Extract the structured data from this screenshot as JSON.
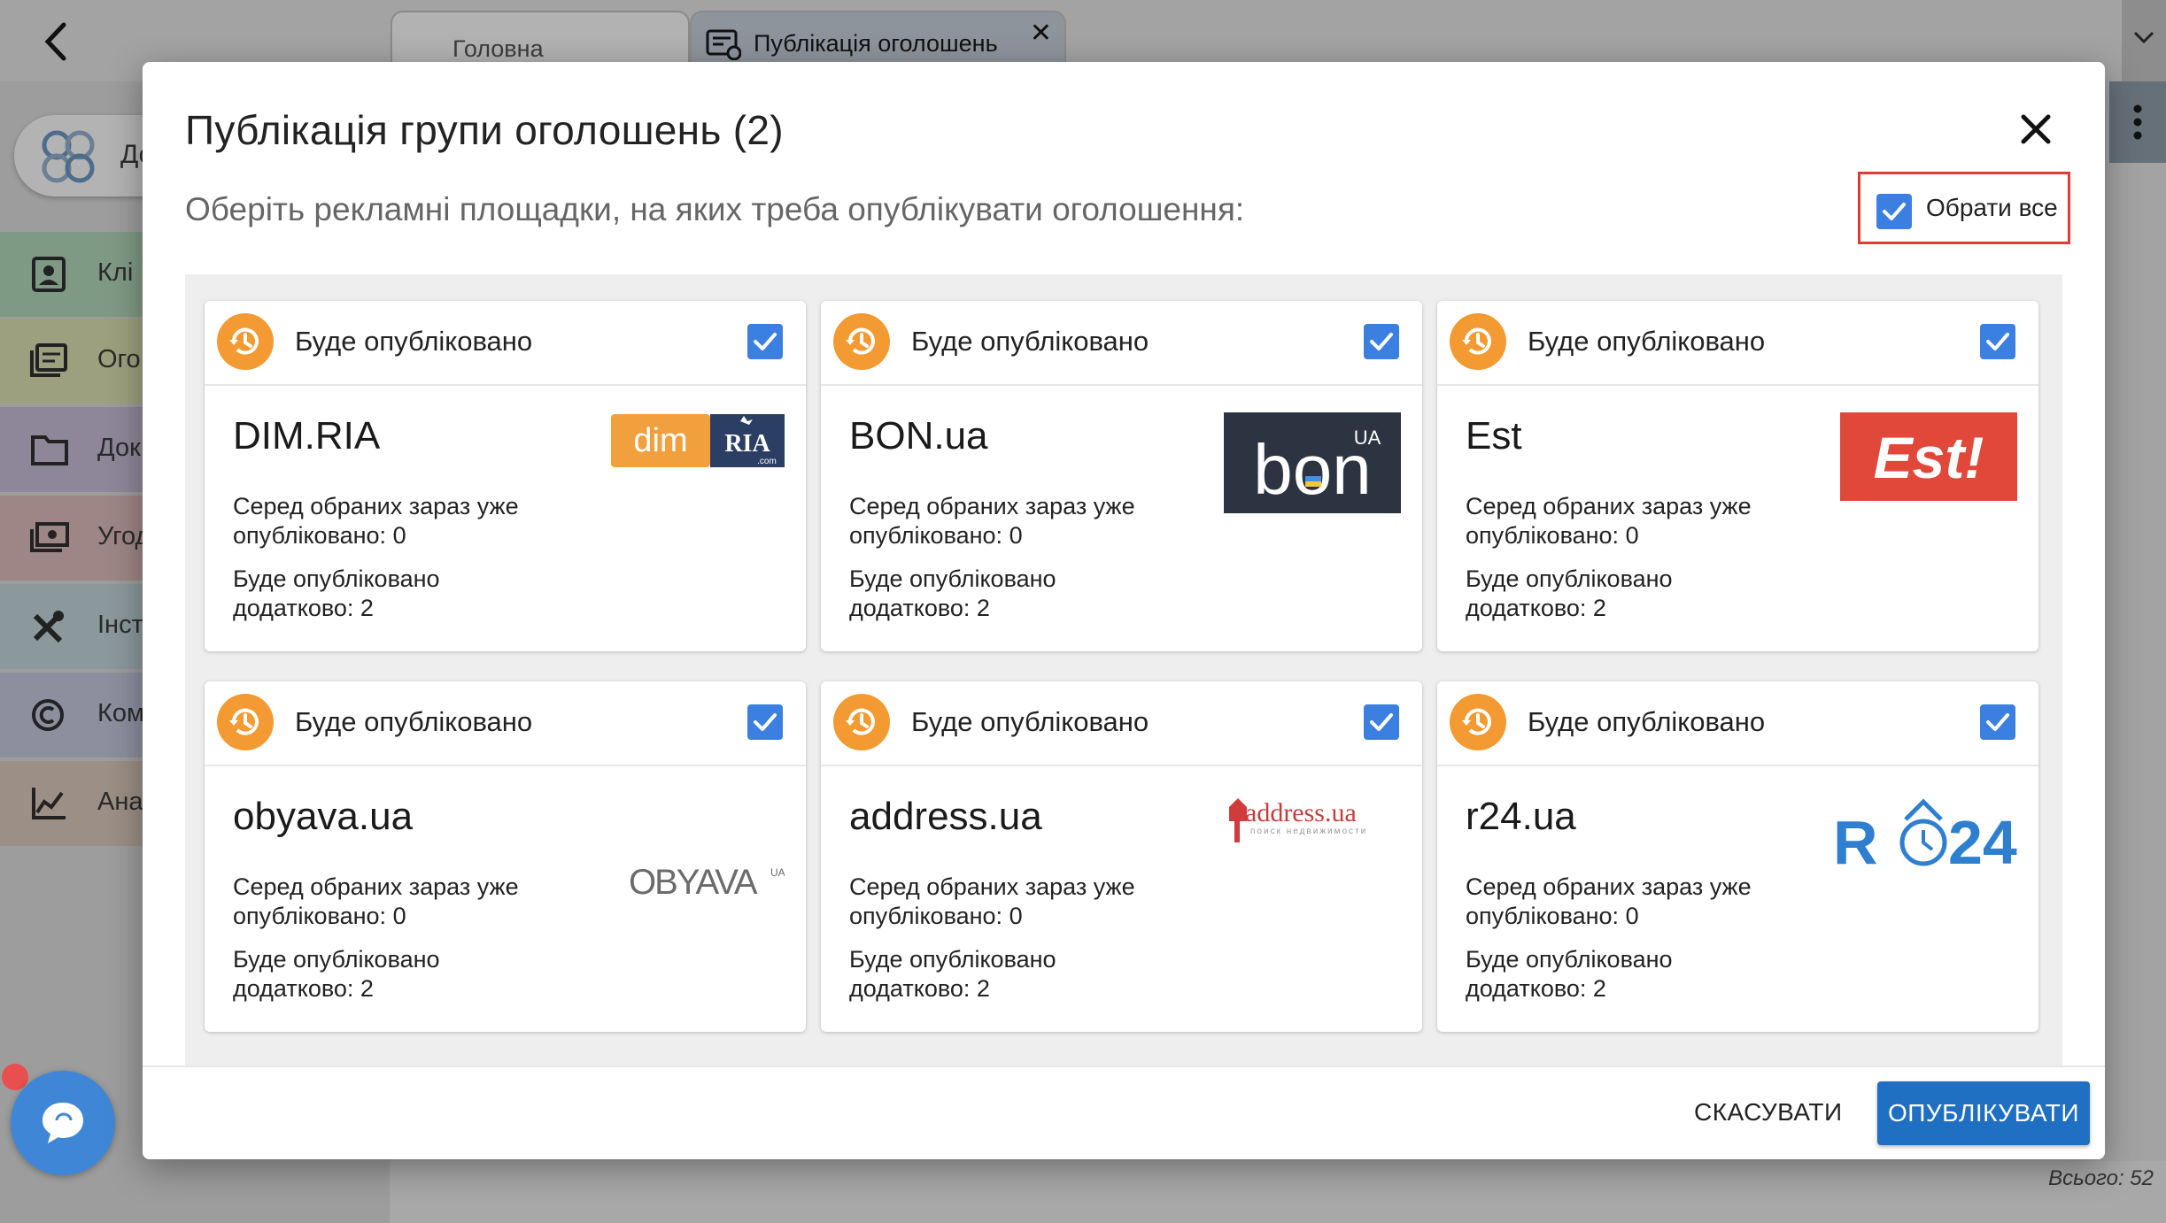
{
  "app": {
    "tabs": [
      {
        "label": "Головна"
      },
      {
        "label": "Публікація оголошень",
        "close": "✕"
      }
    ],
    "account_label": "До",
    "sidebar": [
      {
        "label": "Клі",
        "icon": "contacts-icon"
      },
      {
        "label": "Ого",
        "icon": "listings-icon"
      },
      {
        "label": "Док",
        "icon": "folder-icon"
      },
      {
        "label": "Угод",
        "icon": "deals-icon"
      },
      {
        "label": "Інст",
        "icon": "tools-icon"
      },
      {
        "label": "Ком",
        "icon": "copyright-icon"
      },
      {
        "label": "Ана",
        "icon": "analytics-icon"
      }
    ],
    "total": "Всього: 52"
  },
  "modal": {
    "title": "Публікація групи оголошень (2)",
    "subtitle": "Оберіть рекламні площадки, на яких треба опублікувати оголошення:",
    "select_all": {
      "label": "Обрати все",
      "checked": true
    },
    "cards": [
      {
        "status": "Буде опубліковано",
        "name": "DIM.RIA",
        "stat_a": "Серед обраних зараз уже опубліковано: 0",
        "stat_b": "Буде опубліковано додатково: 2",
        "checked": true,
        "logo": "dim-ria-logo"
      },
      {
        "status": "Буде опубліковано",
        "name": "BON.ua",
        "stat_a": "Серед обраних зараз уже опубліковано: 0",
        "stat_b": "Буде опубліковано додатково: 2",
        "checked": true,
        "logo": "bon-ua-logo"
      },
      {
        "status": "Буде опубліковано",
        "name": "Est",
        "stat_a": "Серед обраних зараз уже опубліковано: 0",
        "stat_b": "Буде опубліковано додатково: 2",
        "checked": true,
        "logo": "est-logo"
      },
      {
        "status": "Буде опубліковано",
        "name": "obyava.ua",
        "stat_a": "Серед обраних зараз уже опубліковано: 0",
        "stat_b": "Буде опубліковано додатково: 2",
        "checked": true,
        "logo": "obyava-logo"
      },
      {
        "status": "Буде опубліковано",
        "name": "address.ua",
        "stat_a": "Серед обраних зараз уже опубліковано: 0",
        "stat_b": "Буде опубліковано додатково: 2",
        "checked": true,
        "logo": "address-ua-logo"
      },
      {
        "status": "Буде опубліковано",
        "name": "r24.ua",
        "stat_a": "Серед обраних зараз уже опубліковано: 0",
        "stat_b": "Буде опубліковано додатково: 2",
        "checked": true,
        "logo": "r24-logo"
      }
    ],
    "buttons": {
      "cancel": "СКАСУВАТИ",
      "publish": "ОПУБЛІКУВАТИ"
    },
    "logo_text": {
      "dim": "dim",
      "ria": "RIA",
      "ria_com": ".com",
      "bon": "bon",
      "bon_ua": "UA",
      "est": "Est!",
      "obyava": "OBYAVA",
      "obyava_ua": "UA",
      "address": "address.ua",
      "address_tagline": "поиск недвижимости",
      "r24_r": "R",
      "r24_num": "24"
    }
  },
  "colors": {
    "accent": "#1f6fc2",
    "checkbox": "#3b7fe0",
    "status_orange": "#f39a33",
    "highlight_red": "#e53935",
    "est_red": "#e2483a",
    "dim_orange": "#f2a03d",
    "bon_dark": "#2c3442",
    "r24_blue": "#2f7fd0"
  }
}
